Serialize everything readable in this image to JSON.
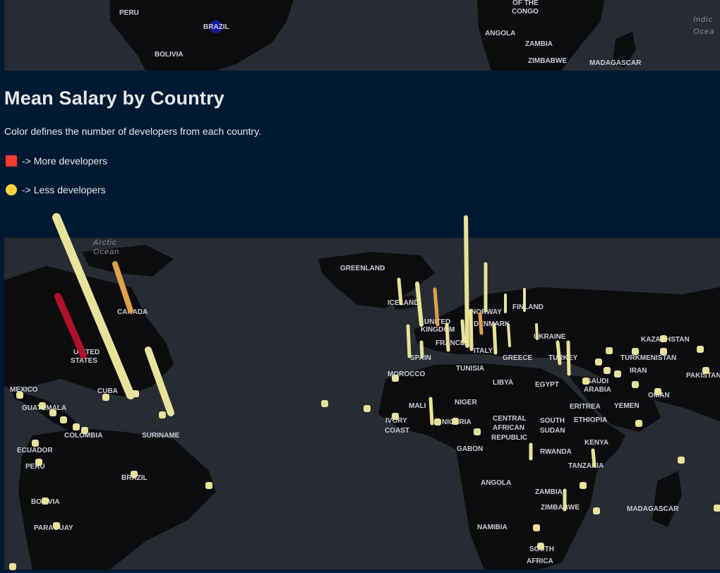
{
  "section": {
    "title": "Mean Salary by Country",
    "caption": "Color defines the number of developers from each country.",
    "legend": [
      {
        "symbol": "red-square",
        "label": "-> More developers",
        "color": "#ff3b30"
      },
      {
        "symbol": "yellow-circle",
        "label": "-> Less developers",
        "color": "#ffd43b"
      }
    ]
  },
  "top_map": {
    "labels": [
      "PERU",
      "BRAZIL",
      "BOLIVIA",
      "OF THE",
      "CONGO",
      "ANGOLA",
      "ZAMBIA",
      "ZIMBABWE",
      "MADAGASCAR",
      "Indic",
      "Ocea"
    ]
  },
  "main_map": {
    "labels": [
      "Arctic",
      "Ocean",
      "GREENLAND",
      "ICELAND",
      "CANADA",
      "UNITED",
      "STATES",
      "MEXICO",
      "CUBA",
      "GUATEMALA",
      "COLOMBIA",
      "SURINAME",
      "ECUADOR",
      "PERU",
      "BRAZIL",
      "BOLIVIA",
      "PARAGUAY",
      "UNITED",
      "KINGDOM",
      "FRANCE",
      "SPAIN",
      "NORWAY",
      "DENMARK",
      "FINLAND",
      "UKRAINE",
      "GREECE",
      "ITALY",
      "TURKEY",
      "KAZAKHSTAN",
      "TURKMENISTAN",
      "PAKISTAN",
      "IRAN",
      "SAUDI",
      "ARABIA",
      "YEMEN",
      "OMAN",
      "MOROCCO",
      "TUNISIA",
      "LIBYA",
      "EGYPT",
      "MALI",
      "NIGER",
      "IVORY",
      "COAST",
      "NIGERIA",
      "CENTRAL",
      "AFRICAN",
      "REPUBLIC",
      "SOUTH",
      "SUDAN",
      "ERITREA",
      "ETHIOPIA",
      "KENYA",
      "GABON",
      "RWANDA",
      "TANZANIA",
      "ANGOLA",
      "ZAMBIA",
      "ZIMBABWE",
      "NAMIBIA",
      "SOUTH",
      "AFRICA",
      "MADAGASCAR"
    ],
    "columns_note_colors": {
      "high": "#b0102a",
      "mid": "#e0a04a",
      "low": "#e8e29a"
    }
  }
}
